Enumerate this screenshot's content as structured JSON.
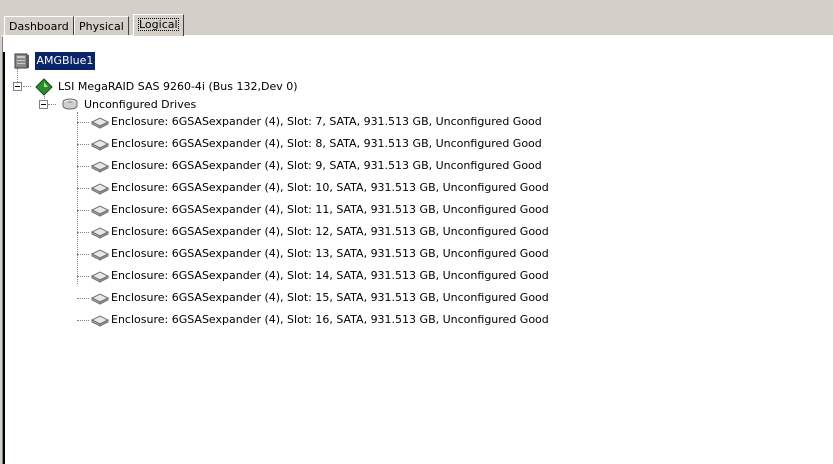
{
  "tabs": [
    {
      "label": "Dashboard",
      "active": false
    },
    {
      "label": "Physical",
      "active": false
    },
    {
      "label": "Logical",
      "active": true
    }
  ],
  "tree": {
    "root": {
      "label": "AMGBlue1",
      "icon": "server-icon",
      "selected": true
    },
    "controller": {
      "label": "LSI MegaRAID SAS 9260-4i (Bus 132,Dev 0)",
      "icon": "controller-diamond-icon"
    },
    "group": {
      "label": "Unconfigured Drives",
      "icon": "drive-group-icon"
    },
    "drives": [
      {
        "label": "Enclosure: 6GSASexpander (4), Slot: 7, SATA, 931.513 GB, Unconfigured Good"
      },
      {
        "label": "Enclosure: 6GSASexpander (4), Slot: 8, SATA, 931.513 GB, Unconfigured Good"
      },
      {
        "label": "Enclosure: 6GSASexpander (4), Slot: 9, SATA, 931.513 GB, Unconfigured Good"
      },
      {
        "label": "Enclosure: 6GSASexpander (4), Slot: 10, SATA, 931.513 GB, Unconfigured Good"
      },
      {
        "label": "Enclosure: 6GSASexpander (4), Slot: 11, SATA, 931.513 GB, Unconfigured Good"
      },
      {
        "label": "Enclosure: 6GSASexpander (4), Slot: 12, SATA, 931.513 GB, Unconfigured Good"
      },
      {
        "label": "Enclosure: 6GSASexpander (4), Slot: 13, SATA, 931.513 GB, Unconfigured Good"
      },
      {
        "label": "Enclosure: 6GSASexpander (4), Slot: 14, SATA, 931.513 GB, Unconfigured Good"
      },
      {
        "label": "Enclosure: 6GSASexpander (4), Slot: 15, SATA, 931.513 GB, Unconfigured Good"
      },
      {
        "label": "Enclosure: 6GSASexpander (4), Slot: 16, SATA, 931.513 GB, Unconfigured Good"
      }
    ]
  },
  "colors": {
    "selection_bg": "#0a246a",
    "selection_fg": "#ffffff",
    "chrome": "#d4d0c8",
    "controller_green": "#2e8b2e"
  }
}
